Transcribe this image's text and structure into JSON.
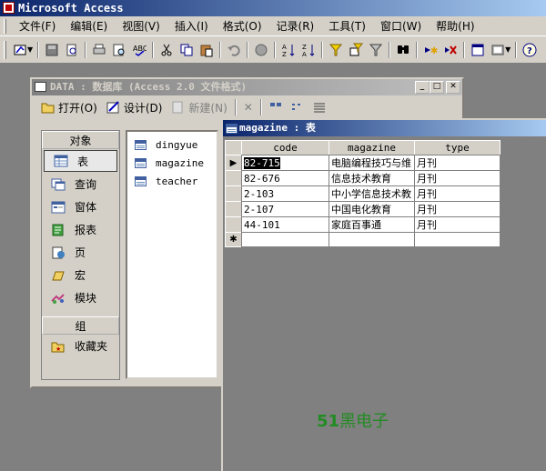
{
  "app": {
    "title": "Microsoft Access"
  },
  "menu": [
    "文件(F)",
    "编辑(E)",
    "视图(V)",
    "插入(I)",
    "格式(O)",
    "记录(R)",
    "工具(T)",
    "窗口(W)",
    "帮助(H)"
  ],
  "toolbar": {
    "icons": [
      "view-icon",
      "save-icon",
      "print-preview-icon",
      "print-icon",
      "preview-icon",
      "spelling-icon",
      "cut-icon",
      "copy-icon",
      "paste-icon",
      "undo-icon",
      "hyperlink-icon",
      "sort-ascending-icon",
      "sort-descending-icon",
      "filter-by-selection-icon",
      "filter-by-form-icon",
      "apply-filter-icon",
      "find-icon",
      "new-record-icon",
      "delete-record-icon",
      "database-window-icon",
      "new-object-icon",
      "help-icon"
    ]
  },
  "db_window": {
    "title": "DATA : 数据库 (Access 2.0 文件格式)",
    "toolbar": {
      "open": "打开(O)",
      "design": "设计(D)",
      "new": "新建(N)"
    },
    "objects_header": "对象",
    "objects": [
      {
        "label": "表",
        "icon": "table-icon",
        "selected": true
      },
      {
        "label": "查询",
        "icon": "query-icon",
        "selected": false
      },
      {
        "label": "窗体",
        "icon": "form-icon",
        "selected": false
      },
      {
        "label": "报表",
        "icon": "report-icon",
        "selected": false
      },
      {
        "label": "页",
        "icon": "page-icon",
        "selected": false
      },
      {
        "label": "宏",
        "icon": "macro-icon",
        "selected": false
      },
      {
        "label": "模块",
        "icon": "module-icon",
        "selected": false
      }
    ],
    "groups_header": "组",
    "groups": [
      {
        "label": "收藏夹",
        "icon": "favorites-icon"
      }
    ],
    "tables": [
      "dingyue",
      "magazine",
      "teacher"
    ]
  },
  "table_window": {
    "title": "magazine : 表",
    "columns": [
      "code",
      "magazine",
      "type"
    ],
    "rows": [
      {
        "code": "82-715",
        "magazine": "电脑编程技巧与维",
        "type": "月刊"
      },
      {
        "code": "82-676",
        "magazine": "信息技术教育",
        "type": "月刊"
      },
      {
        "code": "2-103",
        "magazine": "中小学信息技术教",
        "type": "月刊"
      },
      {
        "code": "2-107",
        "magazine": "中国电化教育",
        "type": "月刊"
      },
      {
        "code": "44-101",
        "magazine": "家庭百事通",
        "type": "月刊"
      }
    ],
    "current_row_marker": "▶",
    "new_row_marker": "✱"
  },
  "watermark": {
    "prefix": "51",
    "suffix": "黑电子"
  }
}
